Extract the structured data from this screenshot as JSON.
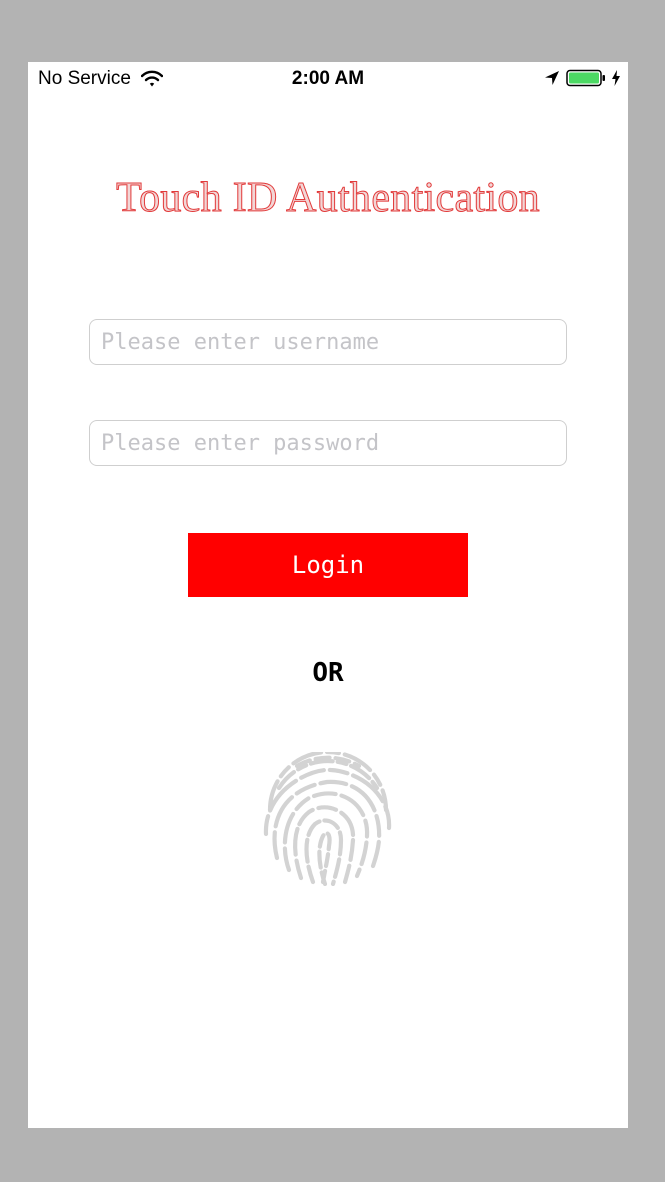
{
  "status_bar": {
    "carrier": "No Service",
    "time": "2:00 AM",
    "icons": [
      "wifi-icon",
      "location-icon",
      "battery-icon",
      "charging-icon"
    ],
    "battery_color": "#4cd964"
  },
  "main": {
    "title": "Touch ID Authentication",
    "username_placeholder": "Please enter username",
    "password_placeholder": "Please enter password",
    "login_label": "Login",
    "or_label": "OR",
    "fingerprint_icon": "fingerprint-icon"
  },
  "colors": {
    "accent": "#ff0000",
    "title": "#e23a3a",
    "background": "#ffffff",
    "frame": "#b3b3b3",
    "fingerprint": "#d3d3d3"
  }
}
